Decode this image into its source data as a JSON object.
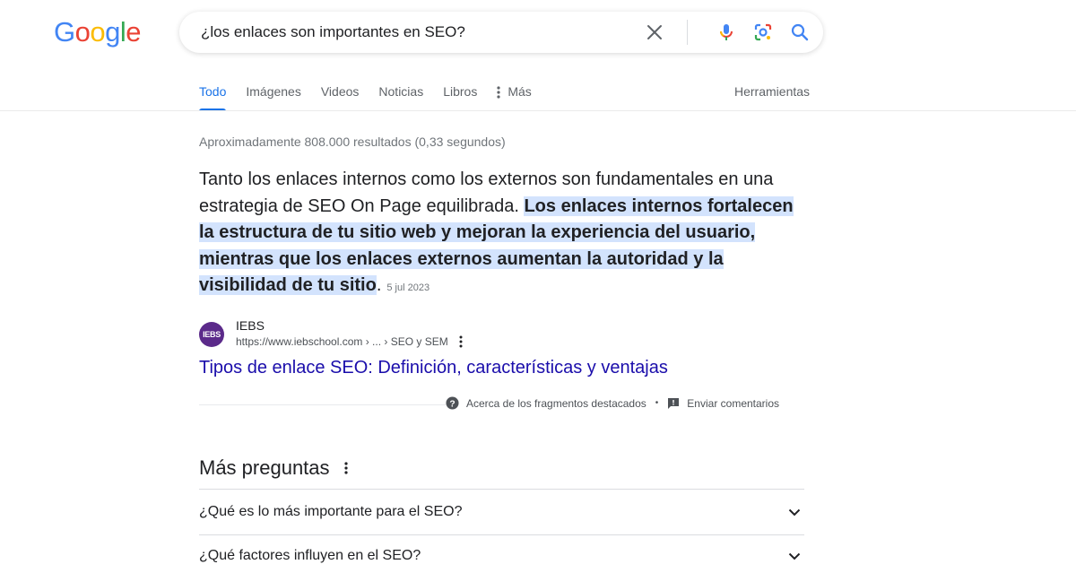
{
  "logo": {
    "letters": [
      "G",
      "o",
      "o",
      "g",
      "l",
      "e"
    ],
    "colors": [
      "#4285F4",
      "#EA4335",
      "#FBBC05",
      "#4285F4",
      "#34A853",
      "#EA4335"
    ]
  },
  "search": {
    "query": "¿los enlaces son importantes en SEO?",
    "icons": [
      "close-icon",
      "microphone-icon",
      "lens-icon",
      "search-icon"
    ]
  },
  "tabs": [
    {
      "label": "Todo",
      "active": true
    },
    {
      "label": "Imágenes",
      "active": false
    },
    {
      "label": "Videos",
      "active": false
    },
    {
      "label": "Noticias",
      "active": false
    },
    {
      "label": "Libros",
      "active": false
    },
    {
      "label": "Más",
      "active": false,
      "icon": "more-vert-icon"
    }
  ],
  "tools_label": "Herramientas",
  "result_stats": "Aproximadamente 808.000 resultados (0,33 segundos)",
  "featured_snippet": {
    "text_plain": "Tanto los enlaces internos como los externos son fundamentales en una estrategia de SEO On Page equilibrada. ",
    "text_highlight": "Los enlaces internos fortalecen la estructura de tu sitio web y mejoran la experiencia del usuario, mientras que los enlaces externos aumentan la autoridad y la visibilidad de tu sitio",
    "text_end": ".",
    "date": "5 jul 2023"
  },
  "source": {
    "favicon_text": "IEBS",
    "name": "IEBS",
    "url": "https://www.iebschool.com › ... › SEO y SEM",
    "title": "Tipos de enlace SEO: Definición, características y ventajas"
  },
  "feedback": {
    "about_label": "Acerca de los fragmentos destacados",
    "bullet": "•",
    "send_label": "Enviar comentarios"
  },
  "paa": {
    "title": "Más preguntas",
    "questions": [
      "¿Qué es lo más importante para el SEO?",
      "¿Qué factores influyen en el SEO?"
    ]
  },
  "colors": {
    "link": "#1a0dab",
    "tab_active": "#1a73e8",
    "highlight": "#d3e3fd"
  }
}
